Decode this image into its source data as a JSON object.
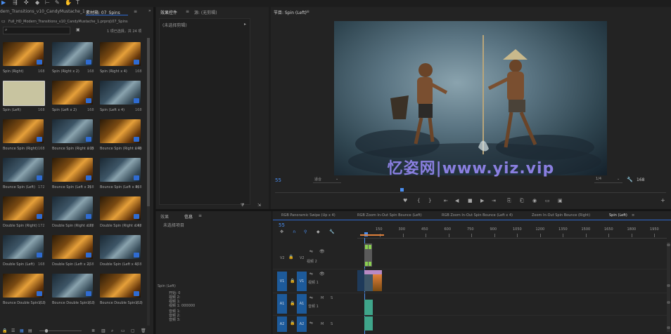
{
  "project_panel": {
    "breadcrumb_tab": "dern_Transitions_v10_CandyMustache_1",
    "bin_tab": "素材箱: 07_Spins",
    "path": "Full_HD_Modern_Transitions_v10_CandyMustache_1.prproj\\07_Spins",
    "selection_info": "1 项已选择，共 24 项",
    "items": [
      {
        "name": "Spin (Right)",
        "dur": "168",
        "style": "warm"
      },
      {
        "name": "Spin (Right x 2)",
        "dur": "168",
        "style": "cool"
      },
      {
        "name": "Spin (Right x 4)",
        "dur": "168",
        "style": "warm"
      },
      {
        "name": "Spin (Left)",
        "dur": "168",
        "style": "sel"
      },
      {
        "name": "Spin (Left x 2)",
        "dur": "168",
        "style": "warm"
      },
      {
        "name": "Spin (Left x 4)",
        "dur": "168",
        "style": "cool"
      },
      {
        "name": "Bounce Spin (Right)",
        "dur": "168",
        "style": "warm"
      },
      {
        "name": "Bounce Spin (Right x 2)",
        "dur": "168",
        "style": "cool"
      },
      {
        "name": "Bounce Spin (Right x 4)",
        "dur": "168",
        "style": "warm"
      },
      {
        "name": "Bounce Spin (Left)",
        "dur": "172",
        "style": "cool"
      },
      {
        "name": "Bounce Spin (Left x 2)",
        "dur": "168",
        "style": "warm"
      },
      {
        "name": "Bounce Spin (Left x 4)",
        "dur": "168",
        "style": "cool"
      },
      {
        "name": "Double Spin (Right)",
        "dur": "172",
        "style": "warm"
      },
      {
        "name": "Double Spin (Right x 2)",
        "dur": "168",
        "style": "cool"
      },
      {
        "name": "Double Spin (Right x 4)",
        "dur": "168",
        "style": "warm"
      },
      {
        "name": "Double Spin (Left)",
        "dur": "168",
        "style": "cool"
      },
      {
        "name": "Double Spin (Left x 2)",
        "dur": "168",
        "style": "warm"
      },
      {
        "name": "Double Spin (Left x 4)",
        "dur": "168",
        "style": "cool"
      },
      {
        "name": "Bounce Double Spin (...)",
        "dur": "168",
        "style": "warm"
      },
      {
        "name": "Bounce Double Spin (...)",
        "dur": "168",
        "style": "cool"
      },
      {
        "name": "Bounce Double Spin (...)",
        "dur": "168",
        "style": "warm"
      }
    ]
  },
  "effect_controls": {
    "tab": "效果控件",
    "tab2": "源: (无剪辑)",
    "no_clip": "(未选择剪辑)"
  },
  "program_monitor": {
    "tab": "节目: Spin (Left)",
    "timecode": "55",
    "fit": "适合",
    "zoom": "1/4",
    "duration": "168",
    "watermark": "忆姿网|www.yiz.vip"
  },
  "info_panel": {
    "tab_effects": "效果",
    "tab_info": "信息",
    "no_item": "未选择项目",
    "seq_name": "Spin (Left)",
    "lines": [
      "开始: 0",
      "视频 2:",
      "视频 1:",
      "视频 1: 000000",
      "音频 1:",
      "音频 2:",
      "音频 3:"
    ]
  },
  "timeline": {
    "tabs": [
      "RGB Panoramic Swipe (Up x 4)",
      "RGB Zoom In-Out Spin Bounce (Left)",
      "RGB Zoom In-Out Spin Bounce (Left x 4)",
      "Zoom In-Out Spin Bounce (Right)",
      "Spin (Left)"
    ],
    "timecode": "55",
    "ruler": [
      "150",
      "300",
      "450",
      "600",
      "750",
      "900",
      "1050",
      "1200",
      "1350",
      "1500",
      "1650",
      "1800",
      "1950"
    ],
    "tracks": [
      {
        "id": "V2",
        "name": "视频 2"
      },
      {
        "id": "V1",
        "name": "视频 1"
      },
      {
        "id": "A1",
        "name": "音频 1"
      },
      {
        "id": "A2",
        "name": "音频 2"
      }
    ],
    "track_small_labels": [
      "M",
      "S",
      "M",
      "S"
    ]
  },
  "colors": {
    "accent_blue": "#2f6bd1",
    "track_blue": "#1d5a9a",
    "clip_pink": "#b88ac4",
    "clip_green": "#3fa58a",
    "clip_orange": "#e0803a"
  }
}
